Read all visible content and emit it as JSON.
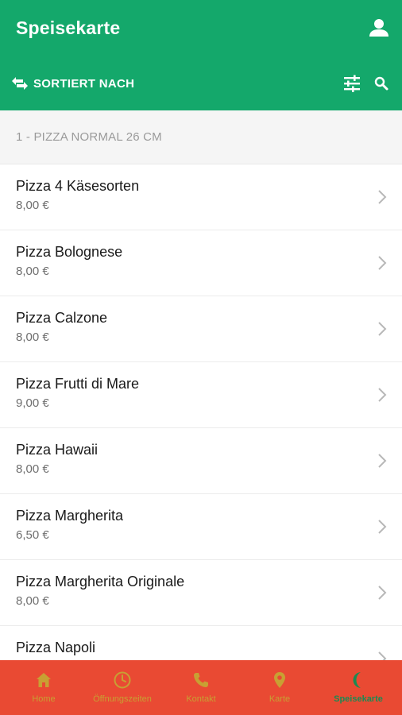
{
  "header": {
    "title": "Speisekarte",
    "sort_label": "SORTIERT NACH",
    "icons": [
      "account-icon",
      "swap-arrows-icon",
      "filter-sliders-icon",
      "search-icon"
    ]
  },
  "category": {
    "title": "1 - PIZZA NORMAL 26 CM"
  },
  "items": [
    {
      "name": "Pizza 4 Käsesorten",
      "price": "8,00 €"
    },
    {
      "name": "Pizza Bolognese",
      "price": "8,00 €"
    },
    {
      "name": "Pizza Calzone",
      "price": "8,00 €"
    },
    {
      "name": "Pizza Frutti di Mare",
      "price": "9,00 €"
    },
    {
      "name": "Pizza Hawaii",
      "price": "8,00 €"
    },
    {
      "name": "Pizza Margherita",
      "price": "6,50 €"
    },
    {
      "name": "Pizza Margherita Originale",
      "price": "8,00 €"
    },
    {
      "name": "Pizza Napoli",
      "price": ""
    }
  ],
  "tabbar": {
    "tabs": [
      {
        "label": "Home",
        "icon": "home-icon"
      },
      {
        "label": "Öffnungszeiten",
        "icon": "clock-icon"
      },
      {
        "label": "Kontakt",
        "icon": "phone-icon"
      },
      {
        "label": "Karte",
        "icon": "map-pin-icon"
      },
      {
        "label": "Speisekarte",
        "icon": "moon-icon"
      }
    ],
    "active_index": 4
  },
  "colors": {
    "primary_green": "#14a86b",
    "tabbar_red": "#e94a33",
    "tab_inactive": "#c8a033",
    "tab_active": "#1b8a52"
  }
}
